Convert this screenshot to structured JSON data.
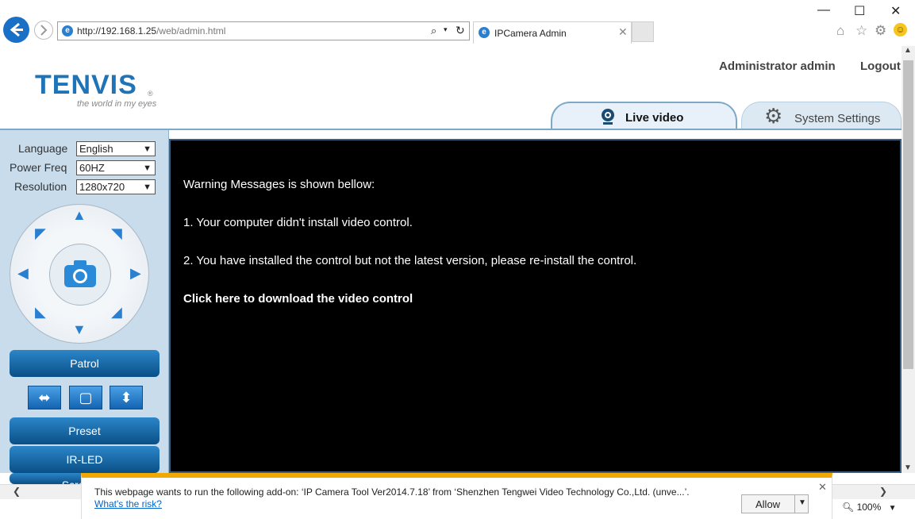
{
  "browser": {
    "url_host": "http://192.168.1.25",
    "url_path": "/web/admin.html",
    "tab_title": "IPCamera Admin",
    "zoom": "100%"
  },
  "header": {
    "logo": "TENVIS",
    "tagline": "the world in my eyes",
    "user_label": "Administrator admin",
    "logout": "Logout",
    "tabs": {
      "live": "Live video",
      "settings": "System Settings"
    }
  },
  "controls": {
    "language_label": "Language",
    "language_value": "English",
    "power_label": "Power Freq",
    "power_value": "60HZ",
    "resolution_label": "Resolution",
    "resolution_value": "1280x720",
    "patrol": "Patrol",
    "preset": "Preset",
    "irled": "IR-LED",
    "screen_partial": "Screen S"
  },
  "video": {
    "line1": "Warning Messages is shown bellow:",
    "line2": "1. Your computer didn't install video control.",
    "line3": "2. You have installed the control but not the latest version, please re-install the control.",
    "download_link": "Click here to download the video control"
  },
  "notification": {
    "message": "This webpage wants to run the following add-on: ‘IP Camera Tool Ver2014.7.18’ from ‘Shenzhen Tengwei Video Technology Co.,Ltd. (unve...’.",
    "risk_link": "What's the risk?",
    "allow": "Allow"
  },
  "colors": {
    "brand_blue": "#1e74b6",
    "accent_button": "#0a4f86",
    "warning_bar": "#f1a800"
  }
}
